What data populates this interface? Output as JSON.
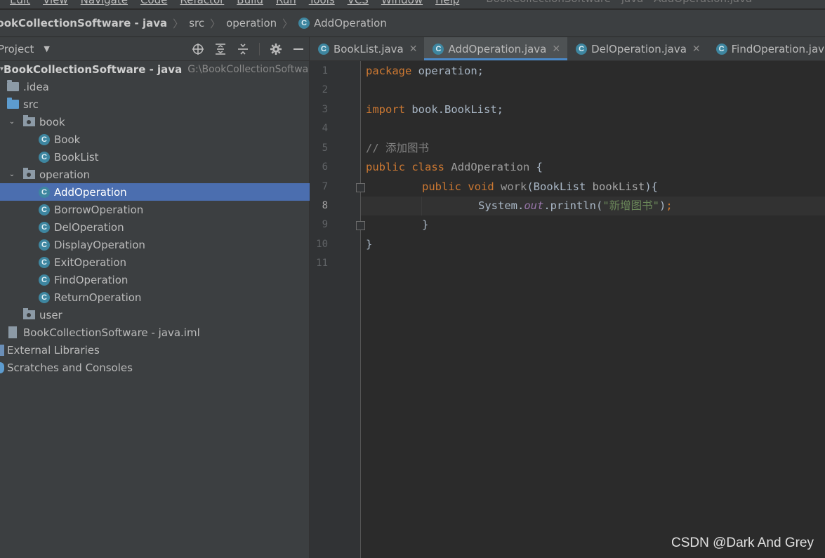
{
  "menubar": {
    "items": [
      "Edit",
      "View",
      "Navigate",
      "Code",
      "Refactor",
      "Build",
      "Run",
      "Tools",
      "VCS",
      "Window",
      "Help"
    ],
    "window_title": "BookCollectionSoftware - java - AddOperation.java"
  },
  "navbar": {
    "crumbs": [
      "BookCollectionSoftware - java",
      "src",
      "operation",
      "AddOperation"
    ]
  },
  "project_panel": {
    "title": "Project",
    "tools": [
      "locate-icon",
      "expand-all-icon",
      "collapse-all-icon",
      "gear-icon",
      "minimize-icon"
    ],
    "root_label": "BookCollectionSoftware - java",
    "root_path": "G:\\BookCollectionSoftware",
    "items": [
      {
        "label": ".idea"
      },
      {
        "label": "src"
      },
      {
        "label": "book"
      },
      {
        "label": "Book"
      },
      {
        "label": "BookList"
      },
      {
        "label": "operation"
      },
      {
        "label": "AddOperation"
      },
      {
        "label": "BorrowOperation"
      },
      {
        "label": "DelOperation"
      },
      {
        "label": "DisplayOperation"
      },
      {
        "label": "ExitOperation"
      },
      {
        "label": "FindOperation"
      },
      {
        "label": "ReturnOperation"
      },
      {
        "label": "user"
      },
      {
        "label": "BookCollectionSoftware - java.iml"
      },
      {
        "label": "External Libraries"
      },
      {
        "label": "Scratches and Consoles"
      }
    ]
  },
  "tabs": [
    {
      "label": "BookList.java"
    },
    {
      "label": "AddOperation.java"
    },
    {
      "label": "DelOperation.java"
    },
    {
      "label": "FindOperation.java"
    }
  ],
  "editor": {
    "line_numbers": [
      "1",
      "2",
      "3",
      "4",
      "5",
      "6",
      "7",
      "8",
      "9",
      "10",
      "11"
    ],
    "current_line": 8,
    "code": {
      "l1_kw": "package",
      "l1_rest": " operation;",
      "l3_kw": "import",
      "l3_rest": " book.BookList;",
      "l5_comment": "// 添加图书",
      "l6_kw1": "public",
      "l6_kw2": "class",
      "l6_name": "AddOperation",
      "l6_rest": " {",
      "l7_kw1": "public",
      "l7_kw2": "void",
      "l7_fn": "work",
      "l7_p1": "(BookList ",
      "l7_param": "bookList",
      "l7_p2": "){",
      "l8_a": "System.",
      "l8_out": "out",
      "l8_b": ".println(",
      "l8_str": "\"新增图书\"",
      "l8_c": ")",
      "l8_semi": ";",
      "l9_brace": "}",
      "l10_brace": "}"
    }
  },
  "watermark": "CSDN @Dark And Grey",
  "colors": {
    "selection": "#4b6eaf",
    "keyword": "#cc7832",
    "string": "#6a8759",
    "comment": "#808080",
    "class_icon": "#3e86a0"
  }
}
